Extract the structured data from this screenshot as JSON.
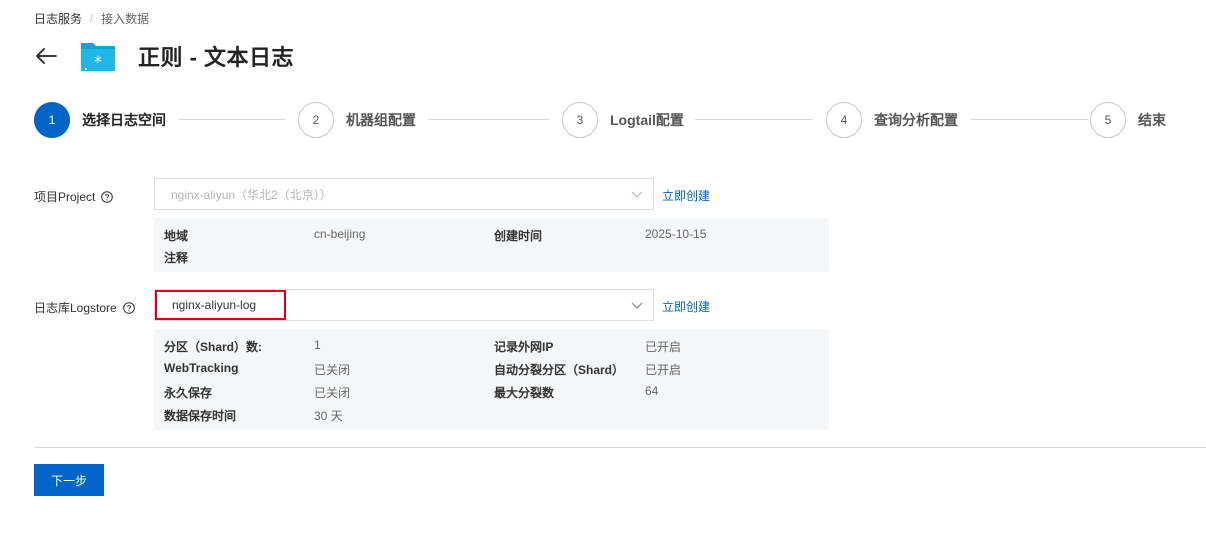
{
  "breadcrumb": {
    "parent": "日志服务",
    "separator": "/",
    "current": "接入数据"
  },
  "header": {
    "title": "正则 - 文本日志",
    "back_icon": "arrow-left-icon",
    "folder_icon": "folder-icon",
    "accent": "#0aa5d6"
  },
  "steps": [
    {
      "num": "1",
      "label": "选择日志空间",
      "active": true
    },
    {
      "num": "2",
      "label": "机器组配置",
      "active": false
    },
    {
      "num": "3",
      "label": "Logtail配置",
      "active": false
    },
    {
      "num": "4",
      "label": "查询分析配置",
      "active": false
    },
    {
      "num": "5",
      "label": "结束",
      "active": false
    }
  ],
  "project": {
    "label": "项目Project",
    "value": "nginx-aliyun（华北2（北京））",
    "create_link": "立即创建",
    "info": {
      "region_key": "地域",
      "region_val": "cn-beijing",
      "created_key": "创建时间",
      "created_val": "2025-10-15",
      "note_key": "注释"
    }
  },
  "logstore": {
    "label": "日志库Logstore",
    "value": "nginx-aliyun-log",
    "create_link": "立即创建",
    "info": {
      "shard_key": "分区（Shard）数:",
      "shard_val": "1",
      "ip_key": "记录外网IP",
      "ip_val": "已开启",
      "webtracking_key": "WebTracking",
      "webtracking_val": "已关闭",
      "autosplit_key": "自动分裂分区（Shard）",
      "autosplit_val": "已开启",
      "permanent_key": "永久保存",
      "permanent_val": "已关闭",
      "maxsplit_key": "最大分裂数",
      "maxsplit_val": "64",
      "retention_key": "数据保存时间",
      "retention_val": "30 天"
    }
  },
  "footer": {
    "next_label": "下一步"
  },
  "colors": {
    "primary": "#0064c8",
    "highlight_border": "#d9001b"
  }
}
